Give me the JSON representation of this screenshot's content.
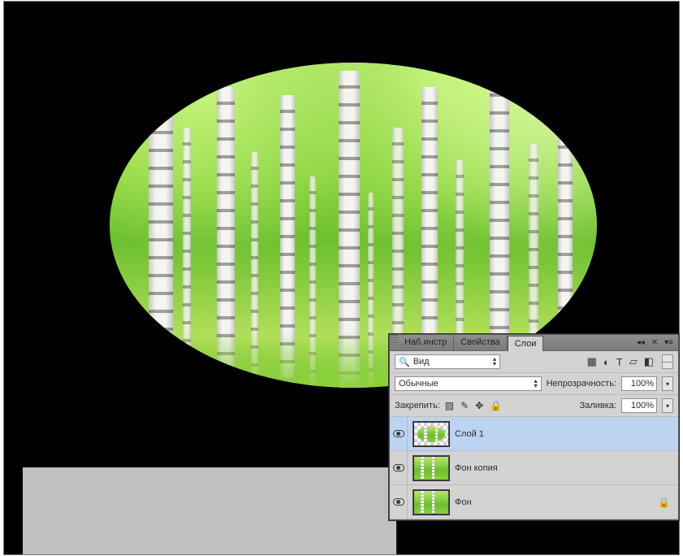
{
  "panel": {
    "tabs": {
      "presets": "Наб.инстр",
      "properties": "Свойства",
      "layers": "Слои"
    },
    "search_label": "Вид",
    "blend_mode": "Обычные",
    "opacity_label": "Непрозрачность:",
    "opacity_value": "100%",
    "lock_label": "Закрепить:",
    "fill_label": "Заливка:",
    "fill_value": "100%"
  },
  "layers": [
    {
      "name": "Слой 1",
      "oval": true,
      "selected": true,
      "locked": false
    },
    {
      "name": "Фон копия",
      "oval": false,
      "selected": false,
      "locked": false
    },
    {
      "name": "Фон",
      "oval": false,
      "selected": false,
      "locked": true
    }
  ]
}
